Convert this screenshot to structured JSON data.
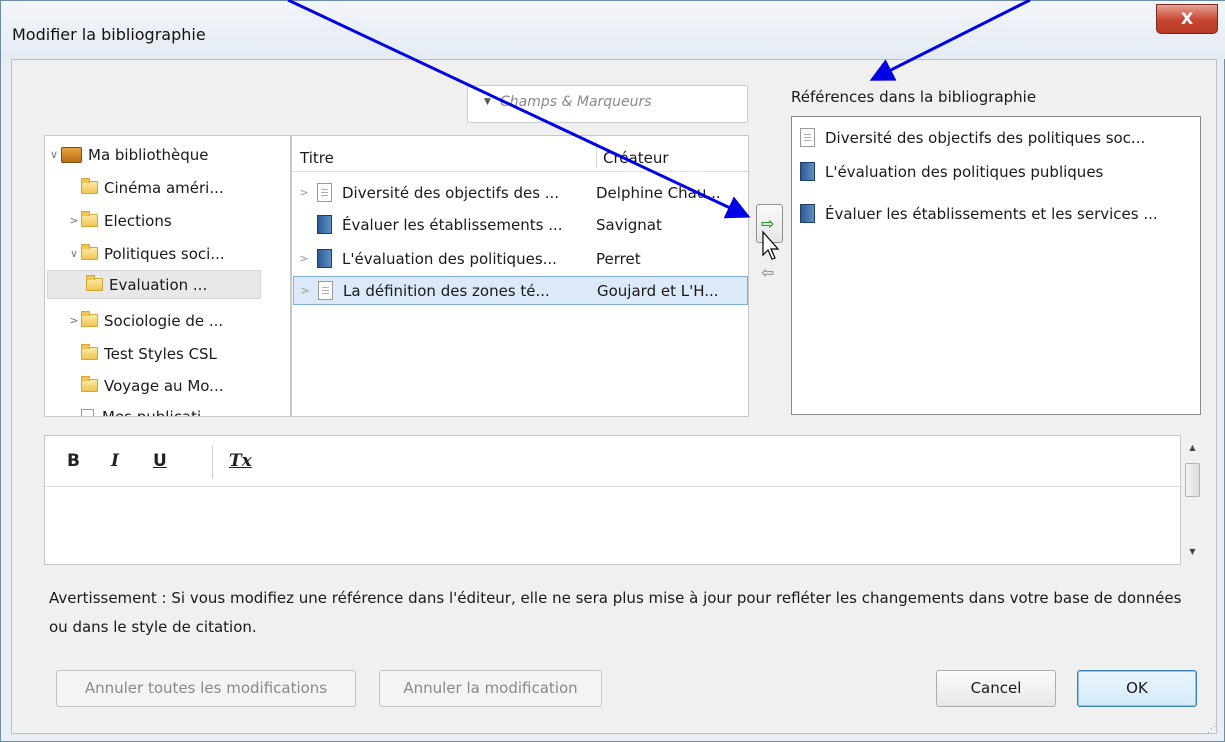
{
  "window": {
    "title": "Modifier la bibliographie",
    "close_glyph": "X"
  },
  "search": {
    "placeholder": "Champs & Marqueurs",
    "dropdown_glyph": "▼"
  },
  "tree": {
    "items": [
      {
        "label": "Ma bibliothèque",
        "twisty": "∨",
        "icon": "library-icon"
      },
      {
        "label": "Cinéma améri...",
        "twisty": "",
        "icon": "folder-icon"
      },
      {
        "label": "Elections",
        "twisty": ">",
        "icon": "folder-icon"
      },
      {
        "label": "Politiques soci...",
        "twisty": "∨",
        "icon": "folder-icon"
      },
      {
        "label": "Evaluation ...",
        "twisty": "",
        "icon": "folder-icon",
        "selected": true
      },
      {
        "label": "Sociologie de ...",
        "twisty": ">",
        "icon": "folder-icon"
      },
      {
        "label": "Test Styles CSL",
        "twisty": "",
        "icon": "folder-icon"
      },
      {
        "label": "Voyage au Mo...",
        "twisty": "",
        "icon": "folder-icon"
      },
      {
        "label": "Mes publicati...",
        "twisty": "",
        "icon": "publications-icon"
      }
    ]
  },
  "items_table": {
    "columns": {
      "title": "Titre",
      "creator": "Créateur"
    },
    "rows": [
      {
        "title": "Diversité des objectifs des ...",
        "creator": "Delphine Chau...",
        "icon": "document-icon",
        "twisty": ">"
      },
      {
        "title": "Évaluer les établissements ...",
        "creator": "Savignat",
        "icon": "book-icon",
        "twisty": ""
      },
      {
        "title": "L'évaluation des politiques...",
        "creator": "Perret",
        "icon": "book-icon",
        "twisty": ">"
      },
      {
        "title": "La définition des zones té...",
        "creator": "Goujard et L'H...",
        "icon": "document-icon",
        "twisty": ">",
        "selected": true
      }
    ]
  },
  "transfer": {
    "add_glyph": "⇨",
    "remove_glyph": "⇦"
  },
  "references": {
    "label": "Références dans la bibliographie",
    "items": [
      {
        "title": "Diversité des objectifs des politiques soc...",
        "icon": "document-icon"
      },
      {
        "title": "L'évaluation des politiques publiques",
        "icon": "book-icon"
      },
      {
        "title": "Évaluer les établissements et les services ...",
        "icon": "book-icon"
      }
    ]
  },
  "editor": {
    "bold": "B",
    "italic": "I",
    "underline": "U",
    "clear_format": "Tx",
    "content": ""
  },
  "warning": "Avertissement : Si vous modifiez une référence dans l'éditeur, elle ne sera plus mise à jour pour refléter les changements dans votre base de données ou dans le style de citation.",
  "buttons": {
    "revert_all": "Annuler toutes les modifications",
    "revert": "Annuler la modification",
    "cancel": "Cancel",
    "ok": "OK"
  },
  "colors": {
    "annotation_arrow": "#0000e6",
    "selection": "#dce9f8",
    "add_arrow": "#2e9b2e"
  }
}
